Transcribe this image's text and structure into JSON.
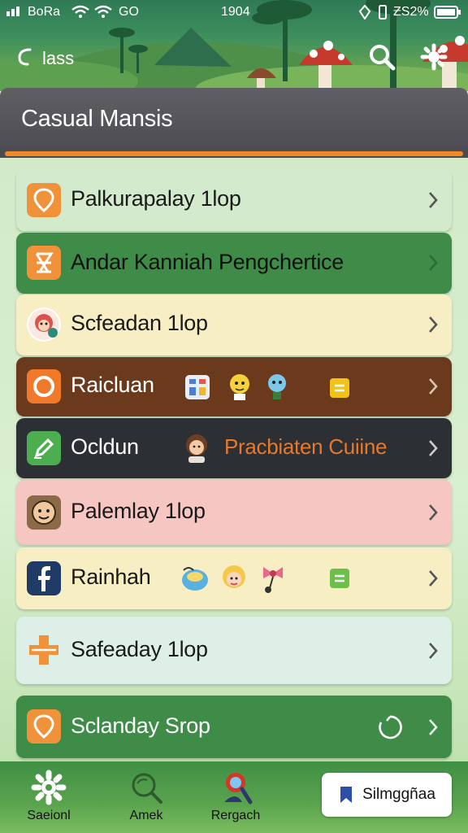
{
  "status_bar": {
    "carrier": "BoRa",
    "speed": "GO",
    "time": "1904",
    "battery": "ƵS2%"
  },
  "header": {
    "back_label": "lass",
    "search_icon": "search-icon",
    "settings_icon": "puzzle-gear-icon"
  },
  "page_title": "Casual Mansis",
  "list": [
    {
      "label": "Palkurapalay 1lop",
      "icon": "location-pin-icon",
      "bg": "#d3ebcc",
      "label_color": "#1a1a1a",
      "chevron_color": "#555555"
    },
    {
      "label": "Andar Kanniah Pengchertice",
      "icon": "hourglass-icon",
      "bg": "#3e8c48",
      "label_color": "#111111",
      "chevron_color": "#2f6b37"
    },
    {
      "label": "Scfeadan 1lop",
      "icon": "monkey-avatar-icon",
      "bg": "#f7eec4",
      "label_color": "#1a1a1a",
      "chevron_color": "#555555"
    },
    {
      "label": "Raicluan",
      "icon": "ring-icon",
      "bg": "#6b3a1c",
      "label_color": "#ffffff",
      "chevron_color": "#d9c4b0"
    },
    {
      "label": "Ocldun",
      "icon": "pencil-icon",
      "bg": "#2c2f33",
      "label_color": "#ffffff",
      "chevron_color": "#cccccc",
      "promo": "Pracbiaten Cuiine"
    },
    {
      "label": "Palemlay 1lop",
      "icon": "face-icon",
      "bg": "#f6c6c2",
      "label_color": "#1a1a1a",
      "chevron_color": "#555555"
    },
    {
      "label": "Rainhah",
      "icon": "facebook-icon",
      "bg": "#f7eec4",
      "label_color": "#1a1a1a",
      "chevron_color": "#555555"
    },
    {
      "label": "Safeaday 1lop",
      "icon": "first-aid-icon",
      "bg": "#deefe8",
      "label_color": "#1a1a1a",
      "chevron_color": "#555555"
    },
    {
      "label": "Sclanday Srop",
      "icon": "location-pin-icon",
      "bg": "#3e8c48",
      "label_color": "#ffffff",
      "chevron_color": "#e8f5e8"
    }
  ],
  "bottom_nav": {
    "tabs": [
      {
        "label": "Saeionl",
        "icon": "gear-icon"
      },
      {
        "label": "Amek",
        "icon": "magnifier-icon"
      },
      {
        "label": "Rergach",
        "icon": "explorer-icon"
      }
    ],
    "cta_label": "Silmggñaa",
    "cta_icon": "bookmark-icon"
  },
  "colors": {
    "accent": "#f08a24",
    "title_bg": "#4f4f55",
    "nav_green": "#4f9c4a"
  }
}
